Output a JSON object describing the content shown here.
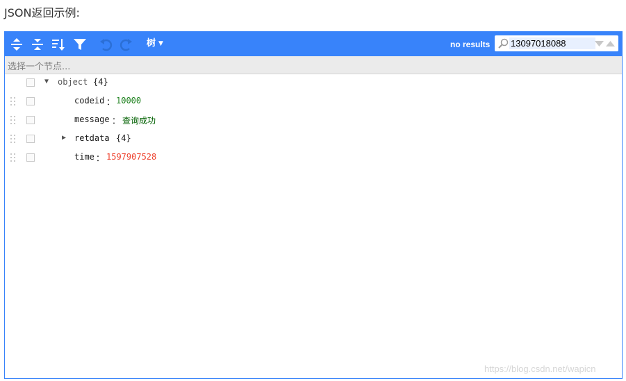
{
  "heading": "JSON返回示例:",
  "toolbar": {
    "expand_icon": "expand-all-icon",
    "collapse_icon": "collapse-all-icon",
    "sort_icon": "sort-icon",
    "filter_icon": "filter-icon",
    "undo_icon": "undo-icon",
    "redo_icon": "redo-icon",
    "mode_label": "树",
    "search_results": "no results",
    "search_value": "13097018088"
  },
  "navbar": {
    "placeholder": "选择一个节点..."
  },
  "tree": {
    "root": {
      "label": "object",
      "count": "{4}"
    },
    "separator": "：",
    "fields": {
      "codeid": {
        "key": "codeid",
        "value": "10000"
      },
      "message": {
        "key": "message",
        "value": "查询成功"
      },
      "retdata": {
        "key": "retdata",
        "count": "{4}"
      },
      "time": {
        "key": "time",
        "value": "1597907528"
      }
    }
  },
  "colors": {
    "accent": "#3883fa",
    "number": "#ee422e",
    "string": "#006000",
    "codeid": "#1a7f1a"
  },
  "watermark": "https://blog.csdn.net/wapicn"
}
